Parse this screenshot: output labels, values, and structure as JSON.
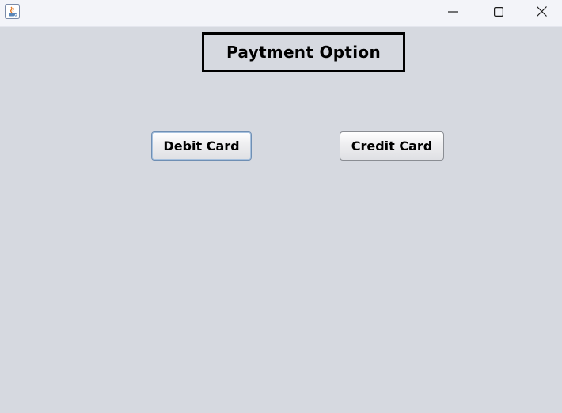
{
  "window": {
    "app_icon": "java-icon",
    "controls": {
      "minimize_icon": "minimize-icon",
      "maximize_icon": "maximize-icon",
      "close_icon": "close-icon"
    }
  },
  "main": {
    "heading": "Paytment Option",
    "buttons": {
      "debit_label": "Debit Card",
      "credit_label": "Credit Card"
    }
  },
  "colors": {
    "background": "#d6d9e0",
    "titlebar": "#f3f4f9",
    "heading_border": "#000000",
    "focus_border": "#6f8fb4"
  }
}
